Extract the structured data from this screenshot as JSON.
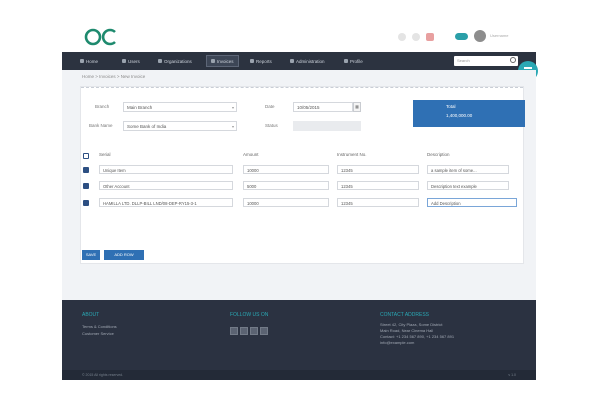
{
  "header": {
    "username": "Username"
  },
  "nav": {
    "items": [
      {
        "label": "Home"
      },
      {
        "label": "Users"
      },
      {
        "label": "Organizations"
      },
      {
        "label": "Invoices"
      },
      {
        "label": "Reports"
      },
      {
        "label": "Administration"
      },
      {
        "label": "Profile"
      }
    ],
    "search_placeholder": "Search"
  },
  "breadcrumb": "Home  >  Invoices  >  New Invoice",
  "form": {
    "branch_label": "Branch",
    "branch_value": "Main Branch",
    "date_label": "Date",
    "date_value": "10/05/2015",
    "bank_label": "Bank Name",
    "bank_value": "Some Bank of India",
    "status_label": "Status",
    "status_value": ""
  },
  "total": {
    "label": "Total",
    "value": "1,400,000.00"
  },
  "table": {
    "headers": [
      "Serial",
      "Amount",
      "Instrument No.",
      "Description"
    ],
    "rows": [
      {
        "serial": "Unique Item",
        "amount": "10000",
        "instrument": "12345",
        "description": "a sample item of some..."
      },
      {
        "serial": "Other Account",
        "amount": "5000",
        "instrument": "12345",
        "description": "Description text example"
      },
      {
        "serial": "HAMILLA LTD. DLLP-BILL LND/08-DEP-RY15-3-1",
        "amount": "10000",
        "instrument": "12345",
        "description": "Add Description"
      }
    ]
  },
  "buttons": {
    "save": "SAVE",
    "add_row": "ADD ROW"
  },
  "footer": {
    "about_title": "ABOUT",
    "about_links": [
      "Terms & Conditions",
      "Customer Service"
    ],
    "follow_title": "FOLLOW US ON",
    "contact_title": "CONTACT ADDRESS",
    "contact_lines": [
      "Street 42, City Plaza, Some District",
      "Main Road, Near Cinema Hall",
      "Contact: +1 234 567 890, +1 234 567 891",
      "info@example.com"
    ],
    "copyright": "© 2015 All rights reserved.",
    "version": "v 1.0"
  },
  "colors": {
    "brand": "#1e8a6e",
    "accent": "#2aa8b4",
    "navbar": "#2c3340",
    "primary_button": "#2f70b4"
  }
}
